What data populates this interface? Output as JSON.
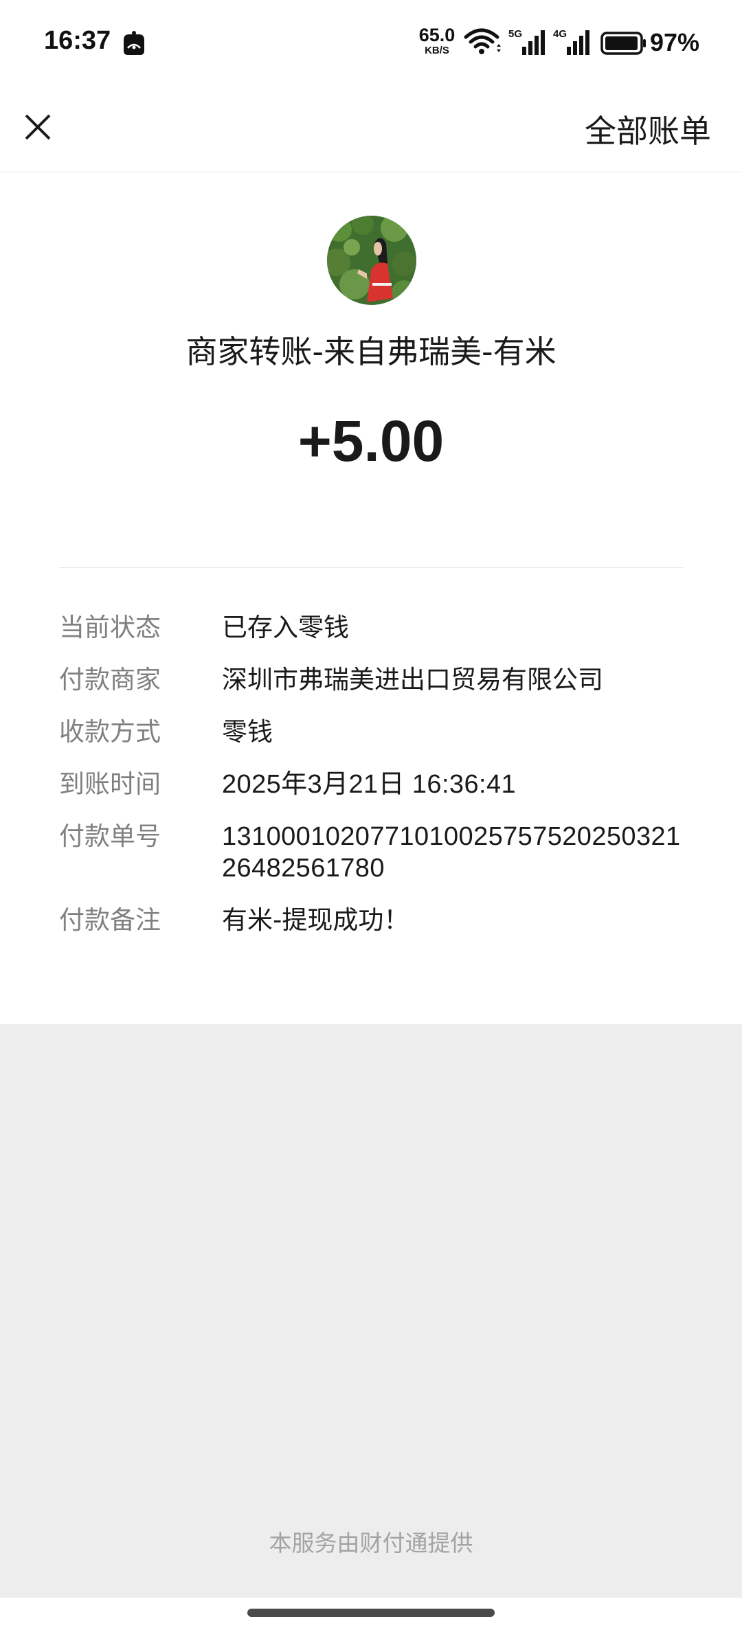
{
  "status_bar": {
    "time": "16:37",
    "net_speed_value": "65.0",
    "net_speed_unit": "KB/S",
    "sig1_label": "5G",
    "sig2_label": "4G",
    "battery_pct": "97%",
    "battery_level": 0.97
  },
  "nav": {
    "close_icon": "close-icon",
    "all_bills_label": "全部账单"
  },
  "payment": {
    "payer_title": "商家转账-来自弗瑞美-有米",
    "amount": "+5.00"
  },
  "details": [
    {
      "label": "当前状态",
      "value": "已存入零钱"
    },
    {
      "label": "付款商家",
      "value": "深圳市弗瑞美进出口贸易有限公司"
    },
    {
      "label": "收款方式",
      "value": "零钱"
    },
    {
      "label": "到账时间",
      "value": "2025年3月21日 16:36:41"
    },
    {
      "label": "付款单号",
      "value": "131000102077101002575752025032126482561780"
    },
    {
      "label": "付款备注",
      "value": "有米-提现成功！"
    }
  ],
  "footer": {
    "provider_note": "本服务由财付通提供"
  },
  "colors": {
    "page_bg": "#ededed",
    "card_bg": "#ffffff",
    "label_gray": "#808080",
    "footer_gray": "#a3a3a3"
  }
}
